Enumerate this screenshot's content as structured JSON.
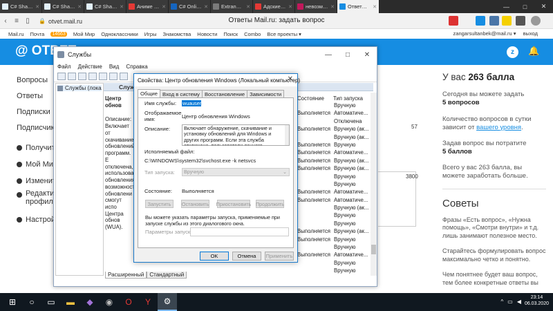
{
  "browser": {
    "tabs": [
      {
        "label": "C# Sharp p",
        "color": "#e3f1fb"
      },
      {
        "label": "C# Sharp E",
        "color": "#e3f1fb"
      },
      {
        "label": "C# Sharp E",
        "color": "#e3f1fb"
      },
      {
        "label": "Аниме Мо",
        "color": "#e53935"
      },
      {
        "label": "C# Online C",
        "color": "#1565c0"
      },
      {
        "label": "Extranet - S",
        "color": "#7a7a7a"
      },
      {
        "label": "Адские гол",
        "color": "#e53935"
      },
      {
        "label": "невозможн",
        "color": "#c2185b"
      },
      {
        "label": "Ответы М",
        "color": "#168de2"
      }
    ],
    "url": "otvet.mail.ru",
    "page_title": "Ответы Mail.ru: задать вопрос",
    "win_controls": [
      "—",
      "□",
      "✕"
    ]
  },
  "portal": {
    "items": [
      "Mail.ru",
      "Почта",
      "Мой Мир",
      "Одноклассники",
      "Игры",
      "Знакомства",
      "Новости",
      "Поиск",
      "Combo",
      "Все проекты ▾"
    ],
    "mail_count": "14663",
    "user": "zangarsultanbek@mail.ru ▾",
    "logout": "выход"
  },
  "site": {
    "logo": "@ ОТВЕТ",
    "avatar_letter": "z",
    "nav": [
      "Вопросы",
      "Ответы",
      "Подписки",
      "Подписчики"
    ],
    "nav2": [
      "Получит",
      "Мой Ми",
      "Изменит",
      "Редакти профил",
      "Настрой"
    ],
    "side_num1": "57",
    "side_num2": "3800"
  },
  "rightcol": {
    "balance_prefix": "У вас ",
    "balance": "263 балла",
    "p1": "Сегодня вы можете задать",
    "p1b": "5 вопросов",
    "p2": "Количество вопросов в сутки зависит от ",
    "p2link": "вашего уровня",
    "p3": "Задав вопрос вы потратите",
    "p3b": "5 баллов",
    "p4": "Всего у вас 263 балла, вы можете заработать больше.",
    "tips_title": "Советы",
    "t1": "Фразы «Есть вопрос», «Нужна помощь», «Смотри внутри» и т.д. лишь занимают полезное место.",
    "t2": "Старайтесь формулировать вопрос максимально четко и понятно.",
    "t3": "Чем понятнее будет ваш вопрос, тем более конкретные ответы вы"
  },
  "services": {
    "title": "Службы",
    "menu": [
      "Файл",
      "Действие",
      "Вид",
      "Справка"
    ],
    "tree_item": "Службы (локальн",
    "header_label": "Служ",
    "desc_title": "Центр обнов",
    "desc_lines": [
      "Описание:",
      "Включает от",
      "скачивание",
      "обновлений",
      "программ. Е",
      "отключена, ",
      "использоват",
      "обновления",
      "возможност",
      "обновлени",
      "смогут испо",
      "Центра обнов",
      "(WUA)."
    ],
    "col_state": "Состояние",
    "col_start": "Тип запуска",
    "rows": [
      [
        "",
        "Вручную"
      ],
      [
        "Выполняется",
        "Автоматиче..."
      ],
      [
        "",
        "Отключена"
      ],
      [
        "Выполняется",
        "Вручную (ак..."
      ],
      [
        "",
        "Вручную (ак..."
      ],
      [
        "Выполняется",
        "Вручную"
      ],
      [
        "Выполняется",
        "Автоматиче..."
      ],
      [
        "Выполняется",
        "Вручную (ак..."
      ],
      [
        "Выполняется",
        "Вручную (ак..."
      ],
      [
        "",
        "Вручную"
      ],
      [
        "",
        "Вручную"
      ],
      [
        "Выполняется",
        "Автоматиче..."
      ],
      [
        "Выполняется",
        "Автоматиче..."
      ],
      [
        "",
        "Вручную (ак..."
      ],
      [
        "",
        "Вручную"
      ],
      [
        "",
        "Вручную"
      ],
      [
        "Выполняется",
        "Вручную (ак..."
      ],
      [
        "Выполняется",
        "Вручную"
      ],
      [
        "",
        "Вручную"
      ],
      [
        "Выполняется",
        "Автоматиче..."
      ],
      [
        "",
        "Вручную"
      ],
      [
        "",
        "Вручную"
      ]
    ],
    "bottom_tabs": [
      "Расширенный",
      "Стандартный"
    ]
  },
  "dialog": {
    "title": "Свойства: Центр обновления Windows (Локальный компьютер)",
    "tabs": [
      "Общие",
      "Вход в систему",
      "Восстановление",
      "Зависимости"
    ],
    "name_label": "Имя службы:",
    "name_value": "wuauserv",
    "display_label1": "Отображаемое",
    "display_label2": "имя:",
    "display_value": "Центр обновления Windows",
    "desc_label": "Описание:",
    "desc_value": "Включает обнаружение, скачивание и установку обновлений для Windows и других программ. Если эта служба отключена, пользователи данного компьютера не смогут использовать",
    "exe_label": "Исполняемый файл:",
    "exe_value": "C:\\WINDOWS\\system32\\svchost.exe -k netsvcs",
    "start_label": "Тип запуска:",
    "start_value": "Вручную",
    "state_label": "Состояние:",
    "state_value": "Выполняется",
    "btn_start": "Запустить",
    "btn_stop": "Остановить",
    "btn_pause": "Приостановить",
    "btn_resume": "Продолжить",
    "hint": "Вы можете указать параметры запуска, применяемые при запуске службы из этого диалогового окна.",
    "params_label": "Параметры запуска:",
    "ok": "OK",
    "cancel": "Отмена",
    "apply": "Применить"
  },
  "taskbar": {
    "time": "23:14",
    "date": "06.03.2020"
  }
}
